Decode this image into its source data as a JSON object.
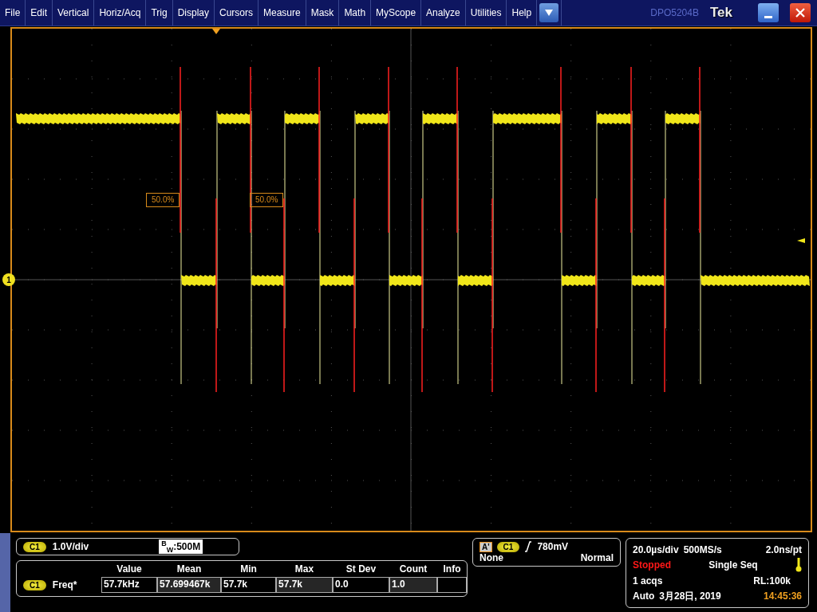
{
  "menu": [
    "File",
    "Edit",
    "Vertical",
    "Horiz/Acq",
    "Trig",
    "Display",
    "Cursors",
    "Measure",
    "Mask",
    "Math",
    "MyScope",
    "Analyze",
    "Utilities",
    "Help"
  ],
  "title_bar": {
    "model": "DPO5204B",
    "brand": "Tek"
  },
  "display": {
    "channel_marker": "1",
    "cursors": [
      {
        "label": "50.0%"
      },
      {
        "label": "50.0%"
      }
    ]
  },
  "channel": {
    "name": "C1",
    "scale": "1.0V/div",
    "bandwidth": "$^{B}$$_{W}$:500M"
  },
  "measurements": {
    "columns": [
      "Value",
      "Mean",
      "Min",
      "Max",
      "St Dev",
      "Count",
      "Info"
    ],
    "rows": [
      {
        "source": "C1",
        "name": "Freq*",
        "cells": [
          "57.7kHz",
          "57.699467k",
          "57.7k",
          "57.7k",
          "0.0",
          "1.0",
          ""
        ]
      }
    ]
  },
  "trigger": {
    "mode_label": "A'",
    "source": "C1",
    "level": "780mV",
    "coupling": "None",
    "sweep": "Normal"
  },
  "acquisition": {
    "timebase": "20.0µs/div",
    "sample_rate": "500MS/s",
    "resolution": "2.0ns/pt",
    "status": "Stopped",
    "run_mode": "Single Seq",
    "acqs": "1 acqs",
    "record_length": "RL:100k",
    "horizontal_mode": "Auto",
    "date": "3月28日, 2019",
    "time": "14:45:36"
  }
}
